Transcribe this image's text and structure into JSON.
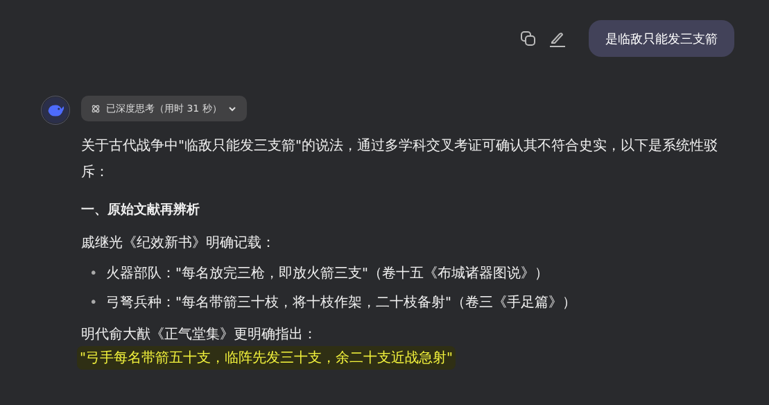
{
  "user_message": {
    "text": "是临敌只能发三支箭"
  },
  "thinking": {
    "label": "已深度思考（用时 31 秒）",
    "expanded": false
  },
  "answer": {
    "intro": "关于古代战争中\"临敌只能发三支箭\"的说法，通过多学科交叉考证可确认其不符合史实，以下是系统性驳斥：",
    "heading": "一、原始文献再辨析",
    "source_1": "戚继光《纪效新书》明确记载：",
    "bullets": [
      {
        "marker": "•",
        "text": "火器部队：\"每名放完三枪，即放火箭三支\"（卷十五《布城诸器图说》）"
      },
      {
        "marker": "•",
        "text": "弓弩兵种：\"每名带箭三十枝，将十枝作架，二十枝备射\"（卷三《手足篇》）"
      }
    ],
    "source_2": "明代俞大猷《正气堂集》更明确指出：",
    "quote": {
      "text": "\"弓手每名带箭五十支，临阵先发三十支，余二十支近战急射\"",
      "highlighted": true
    }
  }
}
